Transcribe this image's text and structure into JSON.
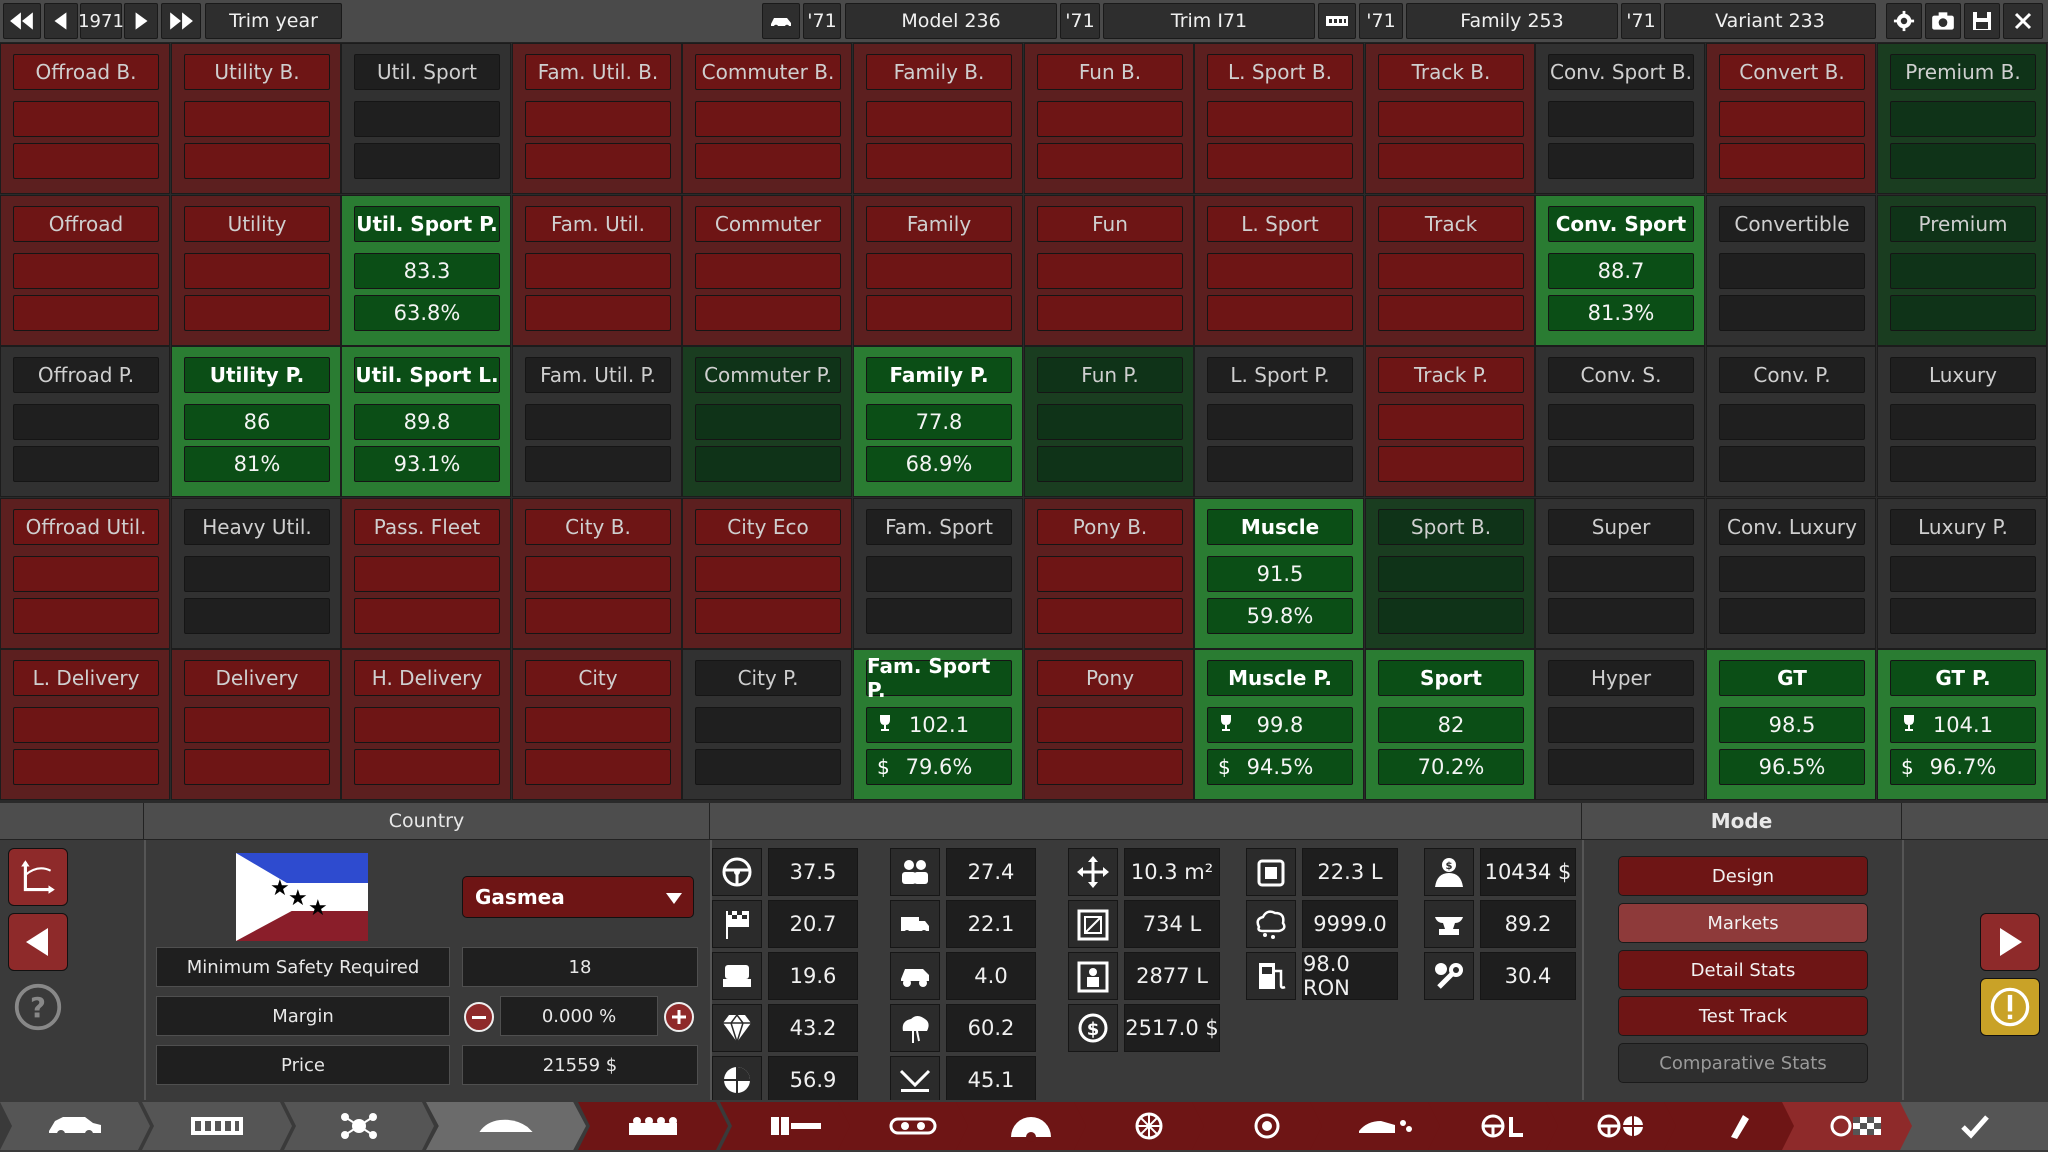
{
  "topbar": {
    "year": "1971",
    "trim_year_label": "Trim year",
    "model_year": "'71",
    "model": "Model 236",
    "trim_year": "'71",
    "trim": "Trim I71",
    "family_year": "'71",
    "family": "Family 253",
    "variant_year": "'71",
    "variant": "Variant 233"
  },
  "grid": [
    [
      {
        "title": "Offroad B.",
        "v1": "",
        "v2": "",
        "color": "red"
      },
      {
        "title": "Utility B.",
        "v1": "",
        "v2": "",
        "color": "red"
      },
      {
        "title": "Util. Sport",
        "v1": "",
        "v2": "",
        "color": "dark"
      },
      {
        "title": "Fam. Util. B.",
        "v1": "",
        "v2": "",
        "color": "red"
      },
      {
        "title": "Commuter B.",
        "v1": "",
        "v2": "",
        "color": "red"
      },
      {
        "title": "Family B.",
        "v1": "",
        "v2": "",
        "color": "red"
      },
      {
        "title": "Fun B.",
        "v1": "",
        "v2": "",
        "color": "red"
      },
      {
        "title": "L. Sport B.",
        "v1": "",
        "v2": "",
        "color": "red"
      },
      {
        "title": "Track B.",
        "v1": "",
        "v2": "",
        "color": "red"
      },
      {
        "title": "Conv. Sport B.",
        "v1": "",
        "v2": "",
        "color": "dark"
      },
      {
        "title": "Convert B.",
        "v1": "",
        "v2": "",
        "color": "red"
      },
      {
        "title": "Premium B.",
        "v1": "",
        "v2": "",
        "color": "dgreen"
      }
    ],
    [
      {
        "title": "Offroad",
        "v1": "",
        "v2": "",
        "color": "red"
      },
      {
        "title": "Utility",
        "v1": "",
        "v2": "",
        "color": "red"
      },
      {
        "title": "Util. Sport P.",
        "v1": "83.3",
        "v2": "63.8%",
        "color": "green"
      },
      {
        "title": "Fam. Util.",
        "v1": "",
        "v2": "",
        "color": "red"
      },
      {
        "title": "Commuter",
        "v1": "",
        "v2": "",
        "color": "red"
      },
      {
        "title": "Family",
        "v1": "",
        "v2": "",
        "color": "red"
      },
      {
        "title": "Fun",
        "v1": "",
        "v2": "",
        "color": "red"
      },
      {
        "title": "L. Sport",
        "v1": "",
        "v2": "",
        "color": "red"
      },
      {
        "title": "Track",
        "v1": "",
        "v2": "",
        "color": "red"
      },
      {
        "title": "Conv. Sport",
        "v1": "88.7",
        "v2": "81.3%",
        "color": "green"
      },
      {
        "title": "Convertible",
        "v1": "",
        "v2": "",
        "color": "dark"
      },
      {
        "title": "Premium",
        "v1": "",
        "v2": "",
        "color": "dgreen"
      }
    ],
    [
      {
        "title": "Offroad P.",
        "v1": "",
        "v2": "",
        "color": "dark"
      },
      {
        "title": "Utility P.",
        "v1": "86",
        "v2": "81%",
        "color": "green"
      },
      {
        "title": "Util. Sport L.",
        "v1": "89.8",
        "v2": "93.1%",
        "color": "green"
      },
      {
        "title": "Fam. Util. P.",
        "v1": "",
        "v2": "",
        "color": "dark"
      },
      {
        "title": "Commuter P.",
        "v1": "",
        "v2": "",
        "color": "dgreen"
      },
      {
        "title": "Family P.",
        "v1": "77.8",
        "v2": "68.9%",
        "color": "green"
      },
      {
        "title": "Fun P.",
        "v1": "",
        "v2": "",
        "color": "dgreen"
      },
      {
        "title": "L. Sport P.",
        "v1": "",
        "v2": "",
        "color": "dark"
      },
      {
        "title": "Track P.",
        "v1": "",
        "v2": "",
        "color": "red"
      },
      {
        "title": "Conv. S.",
        "v1": "",
        "v2": "",
        "color": "dark"
      },
      {
        "title": "Conv. P.",
        "v1": "",
        "v2": "",
        "color": "dark"
      },
      {
        "title": "Luxury",
        "v1": "",
        "v2": "",
        "color": "dark"
      }
    ],
    [
      {
        "title": "Offroad Util.",
        "v1": "",
        "v2": "",
        "color": "red"
      },
      {
        "title": "Heavy Util.",
        "v1": "",
        "v2": "",
        "color": "dark"
      },
      {
        "title": "Pass. Fleet",
        "v1": "",
        "v2": "",
        "color": "red"
      },
      {
        "title": "City B.",
        "v1": "",
        "v2": "",
        "color": "red"
      },
      {
        "title": "City Eco",
        "v1": "",
        "v2": "",
        "color": "red"
      },
      {
        "title": "Fam. Sport",
        "v1": "",
        "v2": "",
        "color": "dark"
      },
      {
        "title": "Pony B.",
        "v1": "",
        "v2": "",
        "color": "red"
      },
      {
        "title": "Muscle",
        "v1": "91.5",
        "v2": "59.8%",
        "color": "green"
      },
      {
        "title": "Sport B.",
        "v1": "",
        "v2": "",
        "color": "dgreen"
      },
      {
        "title": "Super",
        "v1": "",
        "v2": "",
        "color": "dark"
      },
      {
        "title": "Conv. Luxury",
        "v1": "",
        "v2": "",
        "color": "dark"
      },
      {
        "title": "Luxury P.",
        "v1": "",
        "v2": "",
        "color": "dark"
      }
    ],
    [
      {
        "title": "L. Delivery",
        "v1": "",
        "v2": "",
        "color": "red"
      },
      {
        "title": "Delivery",
        "v1": "",
        "v2": "",
        "color": "red"
      },
      {
        "title": "H. Delivery",
        "v1": "",
        "v2": "",
        "color": "red"
      },
      {
        "title": "City",
        "v1": "",
        "v2": "",
        "color": "red"
      },
      {
        "title": "City P.",
        "v1": "",
        "v2": "",
        "color": "dark"
      },
      {
        "title": "Fam. Sport P.",
        "v1": "102.1",
        "v2": "79.6%",
        "color": "green",
        "icons": true
      },
      {
        "title": "Pony",
        "v1": "",
        "v2": "",
        "color": "red"
      },
      {
        "title": "Muscle P.",
        "v1": "99.8",
        "v2": "94.5%",
        "color": "green",
        "icons": true
      },
      {
        "title": "Sport",
        "v1": "82",
        "v2": "70.2%",
        "color": "green"
      },
      {
        "title": "Hyper",
        "v1": "",
        "v2": "",
        "color": "dark"
      },
      {
        "title": "GT",
        "v1": "98.5",
        "v2": "96.5%",
        "color": "green"
      },
      {
        "title": "GT P.",
        "v1": "104.1",
        "v2": "96.7%",
        "color": "green",
        "icons": true
      }
    ]
  ],
  "country": {
    "header": "Country",
    "selected": "Gasmea",
    "min_safety_label": "Minimum Safety Required",
    "min_safety_value": "18",
    "margin_label": "Margin",
    "margin_value": "0.000 %",
    "price_label": "Price",
    "price_value": "21559 $"
  },
  "stats": {
    "col1": [
      {
        "icon": "steering-wheel-icon",
        "value": "37.5"
      },
      {
        "icon": "racing-flag-icon",
        "value": "20.7"
      },
      {
        "icon": "seat-icon",
        "value": "19.6"
      },
      {
        "icon": "diamond-icon",
        "value": "43.2"
      },
      {
        "icon": "safety-icon",
        "value": "56.9"
      }
    ],
    "col2": [
      {
        "icon": "passengers-icon",
        "value": "27.4"
      },
      {
        "icon": "utility-truck-icon",
        "value": "22.1"
      },
      {
        "icon": "offroad-icon",
        "value": "4.0"
      },
      {
        "icon": "environment-icon",
        "value": "60.2"
      },
      {
        "icon": "dependability-icon",
        "value": "45.1"
      }
    ],
    "col3": [
      {
        "icon": "size-icon",
        "value": "10.3 m²"
      },
      {
        "icon": "cargo-volume-icon",
        "value": "734 L"
      },
      {
        "icon": "passenger-volume-icon",
        "value": "2877 L"
      },
      {
        "icon": "cost-icon",
        "value": "2517.0 $"
      }
    ],
    "col4": [
      {
        "icon": "fuel-tank-icon",
        "value": "22.3 L"
      },
      {
        "icon": "emissions-icon",
        "value": "9999.0"
      },
      {
        "icon": "fuel-pump-icon",
        "value": "98.0 RON"
      }
    ],
    "col5": [
      {
        "icon": "price-person-icon",
        "value": "10434 $"
      },
      {
        "icon": "anvil-icon",
        "value": "89.2"
      },
      {
        "icon": "service-wrench-icon",
        "value": "30.4"
      }
    ]
  },
  "mode": {
    "header": "Mode",
    "buttons": [
      "Design",
      "Markets",
      "Detail Stats",
      "Test Track",
      "Comparative Stats"
    ]
  },
  "colors": {
    "red_cell": "#5c1f1f",
    "green_cell": "#2a7c32",
    "dark_green_cell": "#1a3d20",
    "dark_cell": "#313131"
  }
}
